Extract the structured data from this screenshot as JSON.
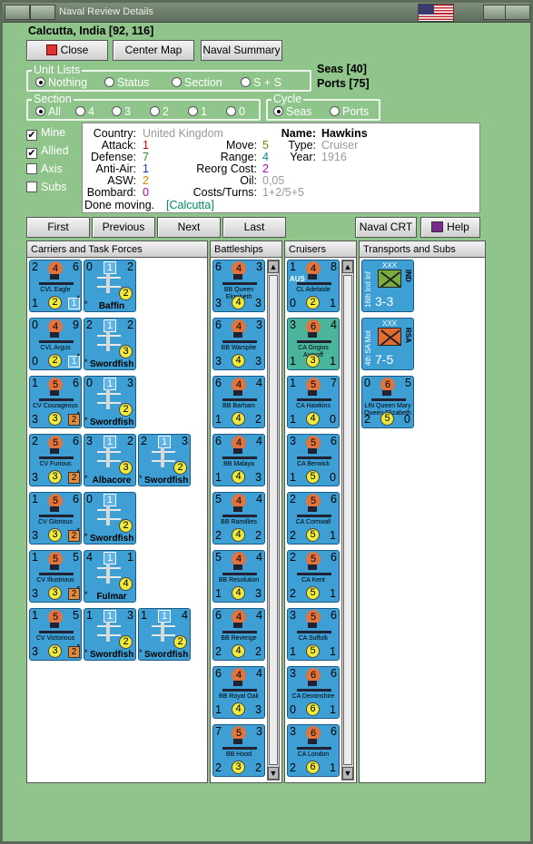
{
  "window": {
    "title": "Naval Review Details"
  },
  "location": "Calcutta, India [92, 116]",
  "buttons": {
    "close": "Close",
    "center_map": "Center Map",
    "naval_summary": "Naval Summary",
    "first": "First",
    "previous": "Previous",
    "next": "Next",
    "last": "Last",
    "naval_crt": "Naval CRT",
    "help": "Help"
  },
  "unit_lists": {
    "caption": "Unit Lists",
    "options": [
      "Nothing",
      "Status",
      "Section",
      "S + S"
    ],
    "selected": "Nothing"
  },
  "seas": "Seas [40]",
  "ports": "Ports [75]",
  "section": {
    "caption": "Section",
    "options": [
      "All",
      "4",
      "3",
      "2",
      "1",
      "0"
    ],
    "selected": "All"
  },
  "cycle": {
    "caption": "Cycle",
    "options": [
      "Seas",
      "Ports"
    ],
    "selected": "Seas"
  },
  "filters": [
    {
      "label": "Mine",
      "checked": true
    },
    {
      "label": "Allied",
      "checked": true
    },
    {
      "label": "Axis",
      "checked": false
    },
    {
      "label": "Subs",
      "checked": false
    }
  ],
  "info": {
    "country_label": "Country:",
    "country": "United Kingdom",
    "attack_label": "Attack:",
    "attack": "1",
    "defense_label": "Defense:",
    "defense": "7",
    "antiair_label": "Anti-Air:",
    "antiair": "1",
    "asw_label": "ASW:",
    "asw": "2",
    "bombard_label": "Bombard:",
    "bombard": "0",
    "move_label": "Move:",
    "move": "5",
    "range_label": "Range:",
    "range": "4",
    "reorg_label": "Reorg Cost:",
    "reorg": "2",
    "oil_label": "Oil:",
    "oil": "0,05",
    "costs_label": "Costs/Turns:",
    "costs": "1+2/5+5",
    "name_label": "Name:",
    "name": "Hawkins",
    "type_label": "Type:",
    "type": "Cruiser",
    "year_label": "Year:",
    "year": "1916",
    "status": "Done moving.",
    "status_loc": "[Calcutta]"
  },
  "panels": {
    "carriers": "Carriers and Task Forces",
    "battleships": "Battleships",
    "cruisers": "Cruisers",
    "transports": "Transports and Subs"
  },
  "carriers": [
    [
      {
        "kind": "ship",
        "tl": "2",
        "circ": "4",
        "tr": "6",
        "name": "CVL Eagle",
        "bl": "1",
        "yc": "2",
        "bsq": "1"
      },
      {
        "kind": "plane",
        "tl": "0",
        "sq": "1",
        "tr": "2",
        "pname": "Baffin",
        "yc": "2",
        "star": "*"
      }
    ],
    [
      {
        "kind": "ship",
        "tl": "0",
        "circ": "4",
        "tr": "9",
        "name": "CVL Argus",
        "bl": "0",
        "yc": "2",
        "bsq": "1"
      },
      {
        "kind": "plane",
        "tl": "2",
        "sq": "1",
        "tr": "2",
        "pname": "Swordfish",
        "yc": "3",
        "star": "*"
      }
    ],
    [
      {
        "kind": "ship",
        "tl": "1",
        "circ": "5",
        "tr": "6",
        "name": "CV Courageous",
        "bl": "3",
        "yc": "3",
        "osq": "2"
      },
      {
        "kind": "plane",
        "tl": "0",
        "sq": "1",
        "tr": "3",
        "pname": "Swordfish",
        "yc": "2",
        "star": "*"
      }
    ],
    [
      {
        "kind": "ship",
        "tl": "2",
        "circ": "5",
        "tr": "6",
        "name": "CV Furious",
        "bl": "3",
        "yc": "3",
        "osq": "2"
      },
      {
        "kind": "plane",
        "tl": "3",
        "sq": "1",
        "tr": "2",
        "pname": "Albacore",
        "yc": "3",
        "star": "*"
      },
      {
        "kind": "plane",
        "tl": "2",
        "sq": "1",
        "tr": "3",
        "pname": "Swordfish",
        "yc": "2",
        "star": "*"
      }
    ],
    [
      {
        "kind": "ship",
        "tl": "1",
        "circ": "5",
        "tr": "6",
        "name": "CV Glorious",
        "bl": "3",
        "yc": "3",
        "osq": "2"
      },
      {
        "kind": "plane",
        "tl": "0",
        "sq": "1",
        "tr": "",
        "pname": "Swordfish",
        "yc": "2",
        "star": "*"
      }
    ],
    [
      {
        "kind": "ship",
        "tl": "1",
        "circ": "5",
        "tr": "5",
        "name": "CV Illustrious",
        "bl": "3",
        "yc": "3",
        "osq": "2"
      },
      {
        "kind": "plane",
        "tl": "4",
        "sq": "1",
        "tr": "1",
        "pname": "Fulmar",
        "yc": "4",
        "star": "*"
      }
    ],
    [
      {
        "kind": "ship",
        "tl": "1",
        "circ": "5",
        "tr": "5",
        "name": "CV Victorious",
        "bl": "3",
        "yc": "3",
        "osq": "2"
      },
      {
        "kind": "plane",
        "tl": "1",
        "sq": "1",
        "tr": "3",
        "pname": "Swordfish",
        "yc": "2",
        "star": "*"
      },
      {
        "kind": "plane",
        "tl": "1",
        "sq": "1",
        "tr": "4",
        "pname": "Swordfish",
        "yc": "2",
        "star": "*"
      }
    ]
  ],
  "battleships": [
    {
      "tl": "6",
      "circ": "4",
      "tr": "3",
      "name": "BB Queen Elizabeth",
      "bl": "3",
      "yc": "4",
      "br": "3"
    },
    {
      "tl": "6",
      "circ": "4",
      "tr": "3",
      "name": "BB Warspite",
      "bl": "3",
      "yc": "4",
      "br": "3"
    },
    {
      "tl": "6",
      "circ": "4",
      "tr": "4",
      "name": "BB Barham",
      "bl": "1",
      "yc": "4",
      "br": "2"
    },
    {
      "tl": "6",
      "circ": "4",
      "tr": "4",
      "name": "BB Malaya",
      "bl": "1",
      "yc": "4",
      "br": "3"
    },
    {
      "tl": "5",
      "circ": "4",
      "tr": "4",
      "name": "BB Ramillies",
      "bl": "2",
      "yc": "4",
      "br": "2"
    },
    {
      "tl": "5",
      "circ": "4",
      "tr": "4",
      "name": "BB Resolution",
      "bl": "1",
      "yc": "4",
      "br": "3"
    },
    {
      "tl": "6",
      "circ": "4",
      "tr": "4",
      "name": "BB Revenge",
      "bl": "2",
      "yc": "4",
      "br": "2"
    },
    {
      "tl": "6",
      "circ": "4",
      "tr": "4",
      "name": "BB Royal Oak",
      "bl": "1",
      "yc": "4",
      "br": "3"
    },
    {
      "tl": "7",
      "circ": "5",
      "tr": "3",
      "name": "BB Hood",
      "bl": "2",
      "yc": "3",
      "br": "2"
    }
  ],
  "cruisers": [
    {
      "tl": "1",
      "circ": "4",
      "tr": "8",
      "name": "CL Adelaide",
      "bl": "0",
      "yc": "2",
      "br": "1",
      "aus": "AUS"
    },
    {
      "tl": "3",
      "circ": "6",
      "tr": "4",
      "name": "CA Girgios Averoff",
      "bl": "1",
      "yc": "3",
      "br": "1",
      "green": true
    },
    {
      "tl": "1",
      "circ": "5",
      "tr": "7",
      "name": "CA Hawkins",
      "bl": "1",
      "yc": "4",
      "br": "0"
    },
    {
      "tl": "3",
      "circ": "5",
      "tr": "6",
      "name": "CA Berwick",
      "bl": "1",
      "yc": "5",
      "br": "0"
    },
    {
      "tl": "2",
      "circ": "5",
      "tr": "6",
      "name": "CA Cornwall",
      "bl": "2",
      "yc": "5",
      "br": "1"
    },
    {
      "tl": "2",
      "circ": "5",
      "tr": "6",
      "name": "CA Kent",
      "bl": "2",
      "yc": "5",
      "br": "1"
    },
    {
      "tl": "3",
      "circ": "5",
      "tr": "6",
      "name": "CA Suffolk",
      "bl": "1",
      "yc": "5",
      "br": "1"
    },
    {
      "tl": "3",
      "circ": "6",
      "tr": "6",
      "name": "CA Devonshire",
      "bl": "0",
      "yc": "6",
      "br": "1"
    },
    {
      "tl": "3",
      "circ": "6",
      "tr": "6",
      "name": "CA London",
      "bl": "2",
      "yc": "6",
      "br": "1"
    }
  ],
  "transports": [
    {
      "kind": "land",
      "vt": "16th Ind Inf",
      "xxx": "XXX",
      "ntn": "IND",
      "str": "3-3",
      "color": "green"
    },
    {
      "kind": "land",
      "vt": "4th SA Mot",
      "xxx": "XXX",
      "ntn": "RSA",
      "str": "7-5",
      "color": "orange"
    },
    {
      "kind": "ship",
      "tl": "0",
      "circ": "6",
      "tr": "5",
      "name": "LIN Queen Mary Queen Elizabeth",
      "bl": "2",
      "yc": "5",
      "br": "0"
    }
  ],
  "colors": {
    "window_bg": "#8fc48a",
    "counter_blue": "#3d9fd4",
    "counter_green": "#4ab59a",
    "attack_red": "#cc0000",
    "defense_green": "#2a8a2a",
    "antiair_blue": "#1a3aa0",
    "asw_orange": "#d08a00",
    "bombard_magenta": "#b000b0"
  }
}
